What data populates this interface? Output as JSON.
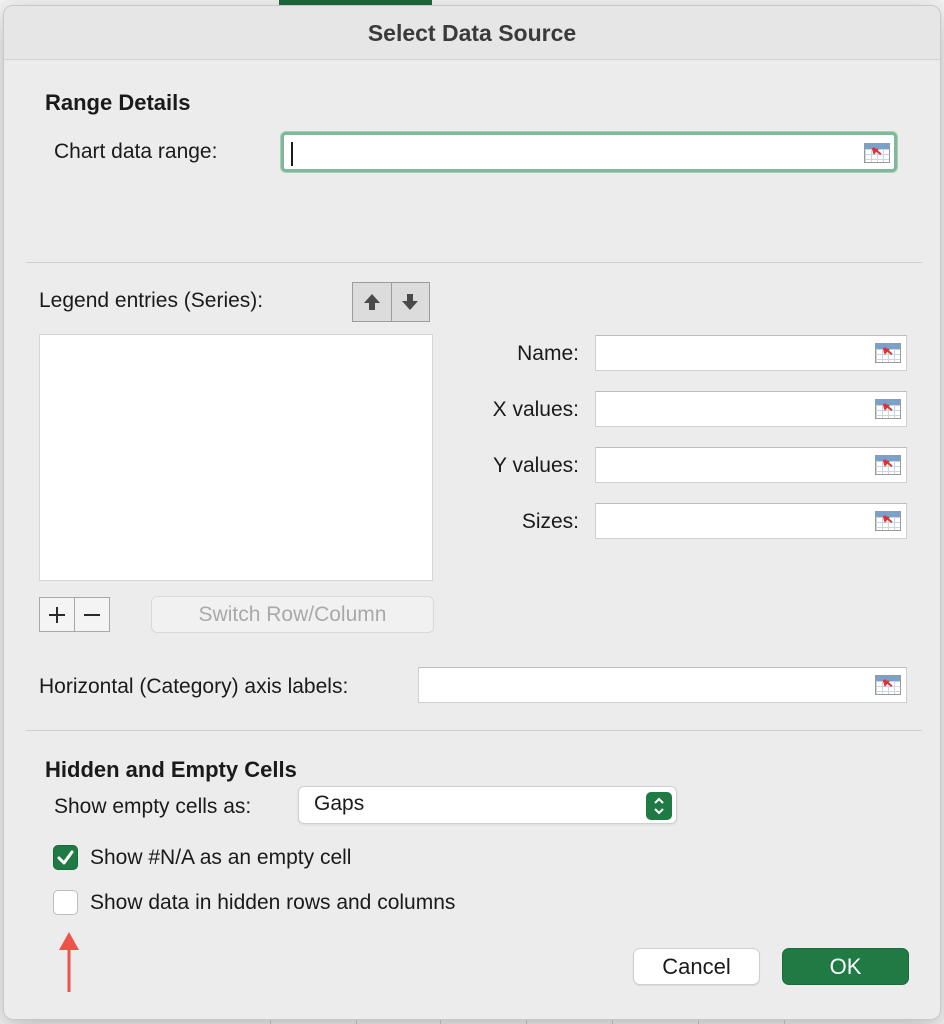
{
  "dialog": {
    "title": "Select Data Source"
  },
  "range_details": {
    "heading": "Range Details",
    "chart_data_range_label": "Chart data range:",
    "chart_data_range_value": ""
  },
  "series": {
    "legend_label": "Legend entries (Series):",
    "move_up_icon": "arrow-up-icon",
    "move_down_icon": "arrow-down-icon",
    "items": [],
    "add_icon": "plus-icon",
    "remove_icon": "minus-icon",
    "switch_button": "Switch Row/Column",
    "fields": {
      "name_label": "Name:",
      "x_values_label": "X values:",
      "y_values_label": "Y values:",
      "sizes_label": "Sizes:"
    }
  },
  "axis": {
    "horizontal_labels_label": "Horizontal (Category) axis labels:"
  },
  "hidden_empty": {
    "heading": "Hidden and Empty Cells",
    "show_empty_label": "Show empty cells as:",
    "show_empty_value": "Gaps",
    "na_checkbox_label": "Show #N/A as an empty cell",
    "na_checked": true,
    "hidden_checkbox_label": "Show data in hidden rows and columns",
    "hidden_checked": false
  },
  "buttons": {
    "cancel": "Cancel",
    "ok": "OK"
  },
  "colors": {
    "accent_green": "#1f7a44",
    "focus_ring": "#7fb89a",
    "annotation_arrow": "#f0524a"
  }
}
